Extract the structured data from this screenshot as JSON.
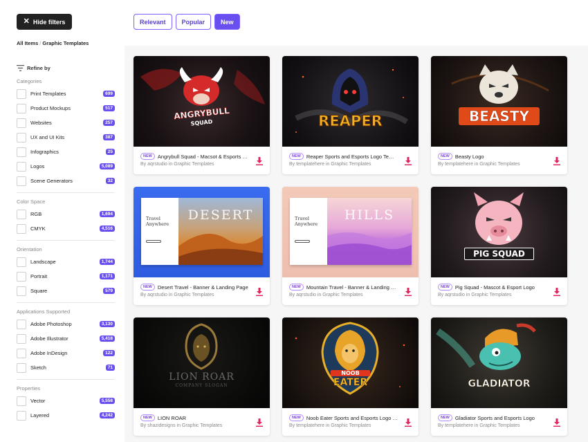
{
  "toolbar": {
    "hide_filters_label": "Hide filters",
    "sort_buttons": [
      "Relevant",
      "Popular",
      "New"
    ],
    "active_sort": "New"
  },
  "breadcrumb": {
    "root": "All Items",
    "separator": "/",
    "current": "Graphic Templates"
  },
  "sidebar": {
    "refine_label": "Refine by",
    "groups": [
      {
        "title": "Categories",
        "items": [
          {
            "label": "Print Templates",
            "count": "699"
          },
          {
            "label": "Product Mockups",
            "count": "517"
          },
          {
            "label": "Websites",
            "count": "257"
          },
          {
            "label": "UX and UI Kits",
            "count": "387"
          },
          {
            "label": "Infographics",
            "count": "25"
          },
          {
            "label": "Logos",
            "count": "5,089"
          },
          {
            "label": "Scene Generators",
            "count": "32"
          }
        ]
      },
      {
        "title": "Color Space",
        "items": [
          {
            "label": "RGB",
            "count": "1,694"
          },
          {
            "label": "CMYK",
            "count": "4,516"
          }
        ]
      },
      {
        "title": "Orientation",
        "items": [
          {
            "label": "Landscape",
            "count": "1,744"
          },
          {
            "label": "Portrait",
            "count": "1,171"
          },
          {
            "label": "Square",
            "count": "579"
          }
        ]
      },
      {
        "title": "Applications Supported",
        "items": [
          {
            "label": "Adobe Photoshop",
            "count": "3,130"
          },
          {
            "label": "Adobe Illustrator",
            "count": "5,418"
          },
          {
            "label": "Adobe InDesign",
            "count": "122"
          },
          {
            "label": "Sketch",
            "count": "71"
          }
        ]
      },
      {
        "title": "Properties",
        "items": [
          {
            "label": "Vector",
            "count": "5,558"
          },
          {
            "label": "Layered",
            "count": "4,242"
          }
        ]
      }
    ]
  },
  "cards": [
    {
      "badge": "NEW",
      "title": "Angrybull Squad - Macsot & Esports Logo",
      "author": "By aqrstudio in Graphic Templates",
      "logo": "ANGRYBULL",
      "logo_sub": "SQUAD"
    },
    {
      "badge": "NEW",
      "title": "Reaper Sports and Esports Logo Template",
      "author": "By templatehere in Graphic Templates",
      "logo": "REAPER"
    },
    {
      "badge": "NEW",
      "title": "Beasty Logo",
      "author": "By templatehere in Graphic Templates",
      "logo": "BEASTY"
    },
    {
      "badge": "NEW",
      "title": "Desert Travel - Banner & Landing Page",
      "author": "By aqrstudio in Graphic Templates",
      "slide_heading": "Travel Anywhere",
      "slide_word": "DESERT"
    },
    {
      "badge": "NEW",
      "title": "Mountain Travel - Banner & Landing Page",
      "author": "By aqrstudio in Graphic Templates",
      "slide_heading": "Travel Anywhere",
      "slide_word": "HILLS"
    },
    {
      "badge": "NEW",
      "title": "Pig Squad - Mascot & Esport Logo",
      "author": "By aqrstudio in Graphic Templates",
      "logo": "PIG SQUAD"
    },
    {
      "badge": "NEW",
      "title": "LION ROAR",
      "author": "By shazidesigns in Graphic Templates",
      "logo": "LION ROAR",
      "logo_sub": "COMPANY SLOGAN"
    },
    {
      "badge": "NEW",
      "title": "Noob Eater Sports and Esports Logo Template",
      "author": "By templatehere in Graphic Templates",
      "logo": "NOOB",
      "logo_sub": "EATER"
    },
    {
      "badge": "NEW",
      "title": "Gladiator Sports and Esports Logo",
      "author": "By templatehere in Graphic Templates",
      "logo": "GLADIATOR"
    }
  ],
  "colors": {
    "accent": "#6a4ff0",
    "download": "#e0245e",
    "dark_button": "#222222"
  }
}
